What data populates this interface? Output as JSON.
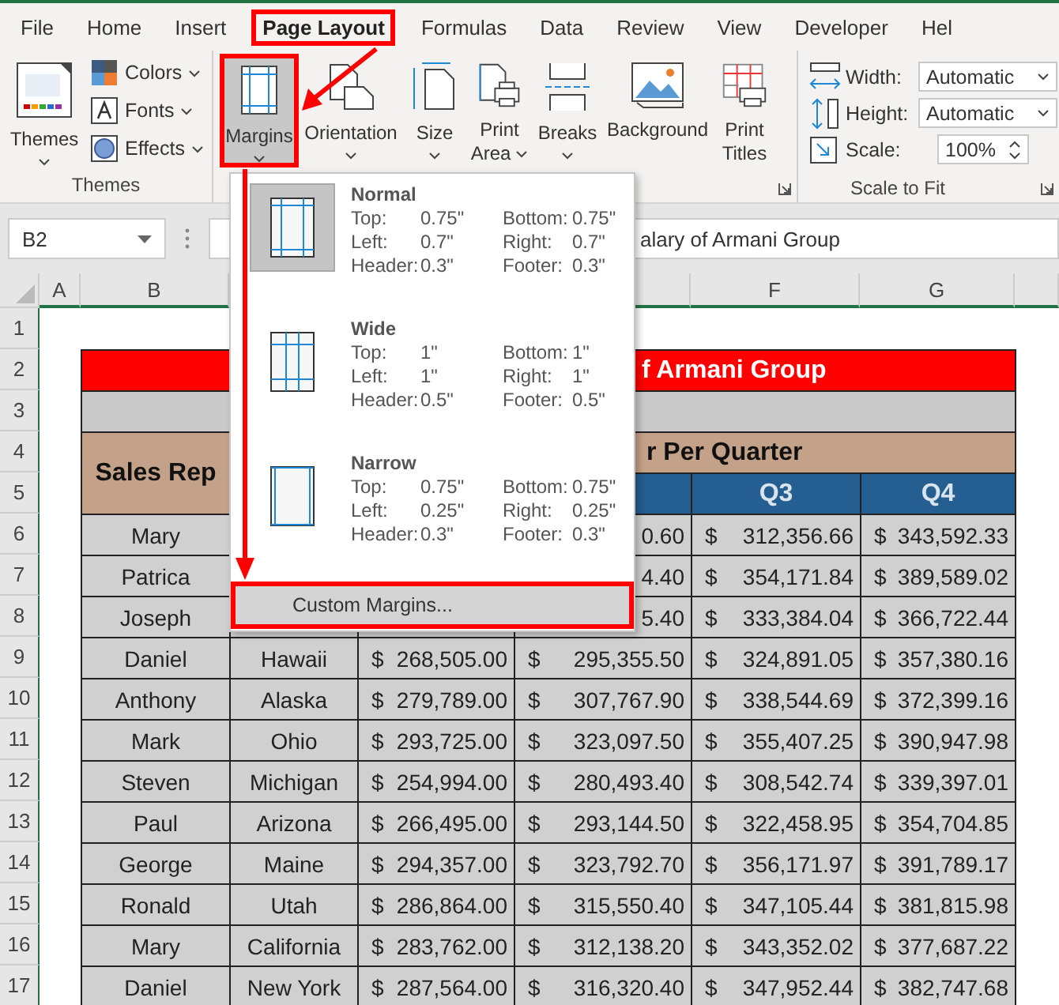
{
  "tabs": [
    {
      "label": "File",
      "selected": false,
      "highlighted": false
    },
    {
      "label": "Home",
      "selected": false,
      "highlighted": false
    },
    {
      "label": "Insert",
      "selected": false,
      "highlighted": false
    },
    {
      "label": "Page Layout",
      "selected": true,
      "highlighted": true
    },
    {
      "label": "Formulas",
      "selected": false,
      "highlighted": false
    },
    {
      "label": "Data",
      "selected": false,
      "highlighted": false
    },
    {
      "label": "Review",
      "selected": false,
      "highlighted": false
    },
    {
      "label": "View",
      "selected": false,
      "highlighted": false
    },
    {
      "label": "Developer",
      "selected": false,
      "highlighted": false
    },
    {
      "label": "Hel",
      "selected": false,
      "highlighted": false
    }
  ],
  "themes_group": {
    "label": "Themes",
    "themes_button": "Themes",
    "buttons": [
      {
        "label": "Colors",
        "kind": "colors"
      },
      {
        "label": "Fonts",
        "kind": "fonts"
      },
      {
        "label": "Effects",
        "kind": "effects"
      }
    ]
  },
  "page_setup": {
    "buttons": [
      {
        "lines": [
          "Margins"
        ],
        "kind": "margins",
        "dropdown": true,
        "selected": true,
        "highlighted": true
      },
      {
        "lines": [
          "Orientation"
        ],
        "kind": "orientation",
        "dropdown": true,
        "selected": false,
        "highlighted": false
      },
      {
        "lines": [
          "Size"
        ],
        "kind": "size",
        "dropdown": true,
        "selected": false,
        "highlighted": false
      },
      {
        "lines": [
          "Print",
          "Area"
        ],
        "kind": "print_area",
        "dropdown": true,
        "selected": false,
        "highlighted": false
      },
      {
        "lines": [
          "Breaks"
        ],
        "kind": "breaks",
        "dropdown": true,
        "selected": false,
        "highlighted": false
      },
      {
        "lines": [
          "Background"
        ],
        "kind": "background",
        "dropdown": false,
        "selected": false,
        "highlighted": false
      },
      {
        "lines": [
          "Print",
          "Titles"
        ],
        "kind": "print_titles",
        "dropdown": false,
        "selected": false,
        "highlighted": false
      }
    ]
  },
  "scale_to_fit": {
    "label": "Scale to Fit",
    "fields": [
      {
        "label": "Width:",
        "value": "Automatic",
        "kind": "width"
      },
      {
        "label": "Height:",
        "value": "Automatic",
        "kind": "height"
      },
      {
        "label": "Scale:",
        "value": "100%",
        "kind": "scale"
      }
    ]
  },
  "formula_bar": {
    "name_box": "B2",
    "formula": "alary of Armani Group"
  },
  "sheet": {
    "column_headers_left": [
      "A",
      "B"
    ],
    "column_headers_right": [
      "F",
      "G"
    ],
    "row_numbers": [
      "1",
      "2",
      "3",
      "4",
      "5",
      "6",
      "7",
      "8",
      "9",
      "10",
      "11",
      "12",
      "13",
      "14",
      "15",
      "16",
      "17"
    ],
    "title": "f Armani Group",
    "sales_rep_header": "Sales Rep",
    "quarter_header": "r Per Quarter",
    "quarters": [
      "Q3",
      "Q4"
    ],
    "rows": [
      {
        "rep": "Mary",
        "q2": "0.60",
        "q3_sign": "$",
        "q3": "312,356.66",
        "q4_sign": "$",
        "q4": "343,592.33"
      },
      {
        "rep": "Patrica",
        "q2": "4.40",
        "q3_sign": "$",
        "q3": "354,171.84",
        "q4_sign": "$",
        "q4": "389,589.02"
      },
      {
        "rep": "Joseph",
        "q2": "5.40",
        "q3_sign": "$",
        "q3": "333,384.04",
        "q4_sign": "$",
        "q4": "366,722.44"
      },
      {
        "rep": "Daniel",
        "location": "Hawaii",
        "q1_sign": "$",
        "q1": "268,505.00",
        "q2_sign": "$",
        "q2": "295,355.50",
        "q3_sign": "$",
        "q3": "324,891.05",
        "q4_sign": "$",
        "q4": "357,380.16"
      },
      {
        "rep": "Anthony",
        "location": "Alaska",
        "q1_sign": "$",
        "q1": "279,789.00",
        "q2_sign": "$",
        "q2": "307,767.90",
        "q3_sign": "$",
        "q3": "338,544.69",
        "q4_sign": "$",
        "q4": "372,399.16"
      },
      {
        "rep": "Mark",
        "location": "Ohio",
        "q1_sign": "$",
        "q1": "293,725.00",
        "q2_sign": "$",
        "q2": "323,097.50",
        "q3_sign": "$",
        "q3": "355,407.25",
        "q4_sign": "$",
        "q4": "390,947.98"
      },
      {
        "rep": "Steven",
        "location": "Michigan",
        "q1_sign": "$",
        "q1": "254,994.00",
        "q2_sign": "$",
        "q2": "280,493.40",
        "q3_sign": "$",
        "q3": "308,542.74",
        "q4_sign": "$",
        "q4": "339,397.01"
      },
      {
        "rep": "Paul",
        "location": "Arizona",
        "q1_sign": "$",
        "q1": "266,495.00",
        "q2_sign": "$",
        "q2": "293,144.50",
        "q3_sign": "$",
        "q3": "322,458.95",
        "q4_sign": "$",
        "q4": "354,704.85"
      },
      {
        "rep": "George",
        "location": "Maine",
        "q1_sign": "$",
        "q1": "294,357.00",
        "q2_sign": "$",
        "q2": "323,792.70",
        "q3_sign": "$",
        "q3": "356,171.97",
        "q4_sign": "$",
        "q4": "391,789.17"
      },
      {
        "rep": "Ronald",
        "location": "Utah",
        "q1_sign": "$",
        "q1": "286,864.00",
        "q2_sign": "$",
        "q2": "315,550.40",
        "q3_sign": "$",
        "q3": "347,105.44",
        "q4_sign": "$",
        "q4": "381,815.98"
      },
      {
        "rep": "Mary",
        "location": "California",
        "q1_sign": "$",
        "q1": "283,762.00",
        "q2_sign": "$",
        "q2": "312,138.20",
        "q3_sign": "$",
        "q3": "343,352.02",
        "q4_sign": "$",
        "q4": "377,687.22"
      },
      {
        "rep": "Daniel",
        "location": "New York",
        "q1_sign": "$",
        "q1": "287,564.00",
        "q2_sign": "$",
        "q2": "316,320.40",
        "q3_sign": "$",
        "q3": "347,952.44",
        "q4_sign": "$",
        "q4": "382,747.68"
      }
    ]
  },
  "margins_menu": {
    "presets": [
      {
        "name": "Normal",
        "kind": "normal",
        "selected": true,
        "settings": [
          {
            "label": "Top:",
            "value": "0.75\""
          },
          {
            "label": "Bottom:",
            "value": "0.75\""
          },
          {
            "label": "Left:",
            "value": "0.7\""
          },
          {
            "label": "Right:",
            "value": "0.7\""
          },
          {
            "label": "Header:",
            "value": "0.3\""
          },
          {
            "label": "Footer:",
            "value": "0.3\""
          }
        ]
      },
      {
        "name": "Wide",
        "kind": "wide",
        "selected": false,
        "settings": [
          {
            "label": "Top:",
            "value": "1\""
          },
          {
            "label": "Bottom:",
            "value": "1\""
          },
          {
            "label": "Left:",
            "value": "1\""
          },
          {
            "label": "Right:",
            "value": "1\""
          },
          {
            "label": "Header:",
            "value": "0.5\""
          },
          {
            "label": "Footer:",
            "value": "0.5\""
          }
        ]
      },
      {
        "name": "Narrow",
        "kind": "narrow",
        "selected": false,
        "settings": [
          {
            "label": "Top:",
            "value": "0.75\""
          },
          {
            "label": "Bottom:",
            "value": "0.75\""
          },
          {
            "label": "Left:",
            "value": "0.25\""
          },
          {
            "label": "Right:",
            "value": "0.25\""
          },
          {
            "label": "Header:",
            "value": "0.3\""
          },
          {
            "label": "Footer:",
            "value": "0.3\""
          }
        ]
      }
    ],
    "custom": {
      "label": "Custom Margins...",
      "highlighted": true
    }
  }
}
